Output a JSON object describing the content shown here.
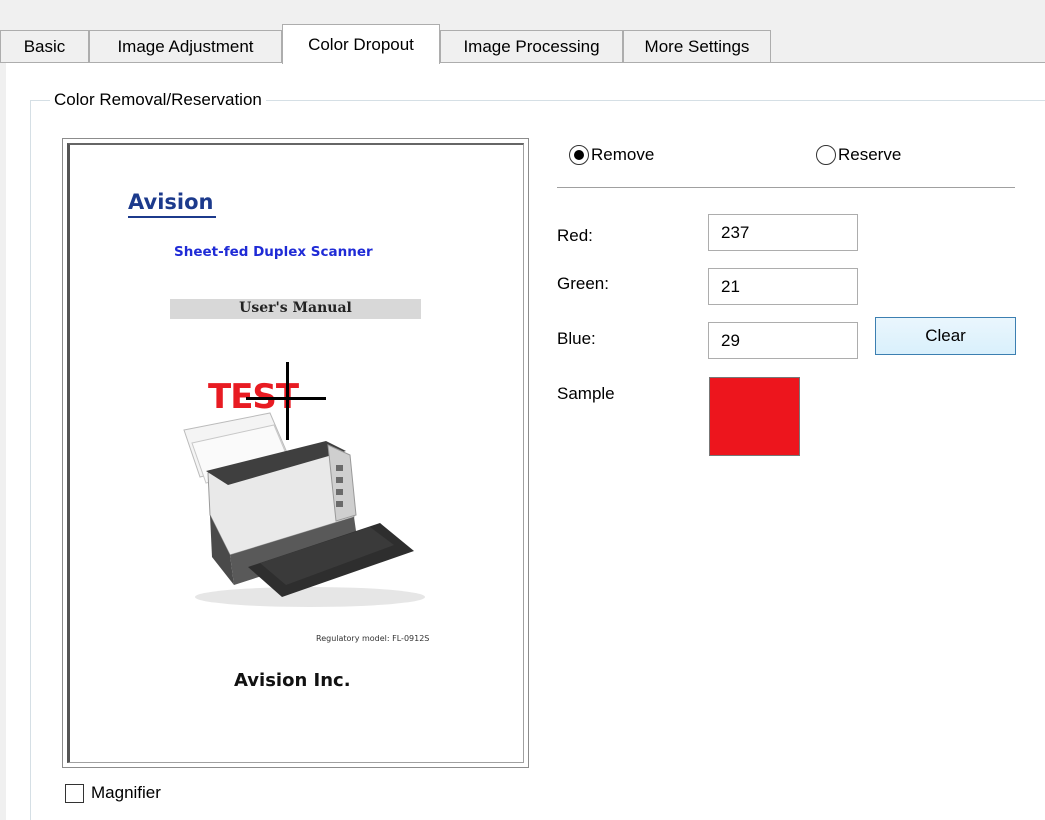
{
  "tabs": [
    {
      "label": "Basic"
    },
    {
      "label": "Image Adjustment"
    },
    {
      "label": "Color Dropout",
      "active": true
    },
    {
      "label": "Image Processing"
    },
    {
      "label": "More Settings"
    }
  ],
  "group": {
    "title": "Color Removal/Reservation"
  },
  "preview": {
    "logo": "Avision",
    "subtitle": "Sheet-fed Duplex Scanner",
    "manual": "User's Manual",
    "test_text": "TEST",
    "regulatory": "Regulatory model: FL-0912S",
    "company": "Avision Inc."
  },
  "magnifier": {
    "label": "Magnifier",
    "checked": false
  },
  "mode": {
    "remove_label": "Remove",
    "reserve_label": "Reserve",
    "selected": "Remove"
  },
  "fields": {
    "red_label": "Red:",
    "red_value": "237",
    "green_label": "Green:",
    "green_value": "21",
    "blue_label": "Blue:",
    "blue_value": "29"
  },
  "clear_label": "Clear",
  "sample": {
    "label": "Sample",
    "color": "#ed151d"
  }
}
